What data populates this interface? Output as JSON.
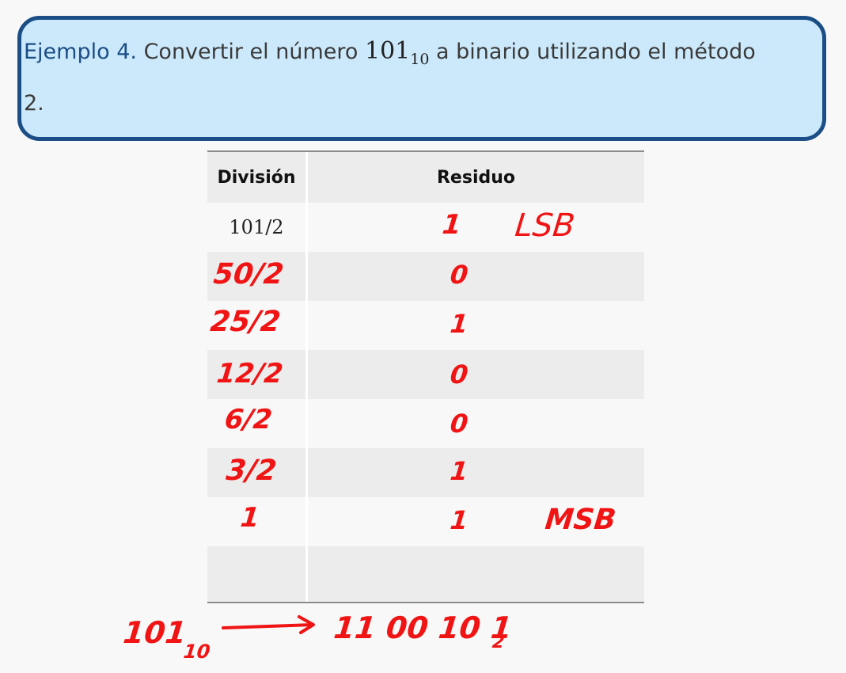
{
  "example": {
    "label": "Ejemplo 4.",
    "text_before": "Convertir el número",
    "number": "101",
    "base": "10",
    "text_after": "a binario utilizando el método",
    "text_line2": "2."
  },
  "table": {
    "headers": [
      "División",
      "Residuo"
    ],
    "rows": [
      {
        "division": "101/2",
        "residuo": "1",
        "note": "LSB"
      },
      {
        "division": "50/2",
        "residuo": "0",
        "note": ""
      },
      {
        "division": "25/2",
        "residuo": "1",
        "note": ""
      },
      {
        "division": "12/2",
        "residuo": "0",
        "note": ""
      },
      {
        "division": "6/2",
        "residuo": "0",
        "note": ""
      },
      {
        "division": "3/2",
        "residuo": "1",
        "note": ""
      },
      {
        "division": "1",
        "residuo": "1",
        "note": "MSB"
      },
      {
        "division": "",
        "residuo": "",
        "note": ""
      }
    ]
  },
  "result": {
    "decimal": "101",
    "decimal_base": "10",
    "binary": "11 00 10 1",
    "binary_base": "2"
  },
  "colors": {
    "box_fill": "#cce9fb",
    "box_border": "#1b4e86",
    "ink": "#f01414"
  }
}
